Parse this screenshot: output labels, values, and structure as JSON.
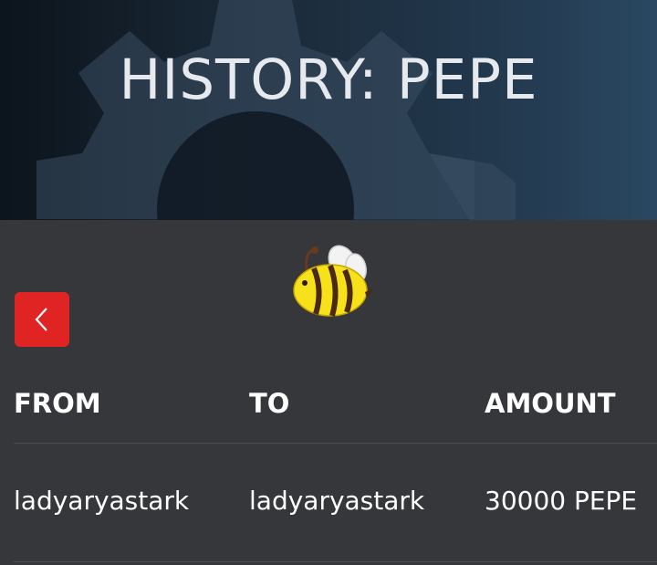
{
  "header": {
    "title": "HISTORY: PEPE"
  },
  "colors": {
    "back_button_bg": "#e02424",
    "content_bg": "#35373b",
    "header_gradient_start": "#0c141c",
    "header_gradient_end": "#2a4862"
  },
  "icons": {
    "back": "chevron-left-icon",
    "logo": "bee-icon",
    "background": "gear-icon"
  },
  "table": {
    "columns": [
      "FROM",
      "TO",
      "AMOUNT"
    ],
    "rows": [
      {
        "from": "ladyaryastark",
        "to": "ladyaryastark",
        "amount": "30000 PEPE"
      }
    ]
  }
}
